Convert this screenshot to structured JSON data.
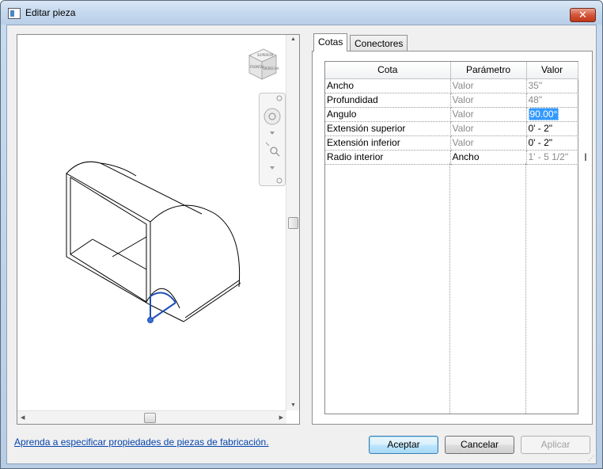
{
  "window": {
    "title": "Editar pieza",
    "close_label": "✕"
  },
  "viewport": {
    "viewcube_labels": [
      "SUPERIOR",
      "FRONTAL",
      "DERECHA"
    ]
  },
  "tabs": [
    {
      "label": "Cotas",
      "active": true
    },
    {
      "label": "Conectores",
      "active": false
    }
  ],
  "grid": {
    "headers": [
      "Cota",
      "Parámetro",
      "Valor"
    ],
    "rows": [
      {
        "cota": "Ancho",
        "parametro": "Valor",
        "valor": "35\""
      },
      {
        "cota": "Profundidad",
        "parametro": "Valor",
        "valor": "48\""
      },
      {
        "cota": "Angulo",
        "parametro": "Valor",
        "valor": "90.00°"
      },
      {
        "cota": "Extensión superior",
        "parametro": "Valor",
        "valor": "0' - 2\""
      },
      {
        "cota": "Extensión inferior",
        "parametro": "Valor",
        "valor": "0' - 2\""
      },
      {
        "cota": "Radio interior",
        "parametro": "Ancho",
        "valor": "1' - 5 1/2\""
      }
    ]
  },
  "footer": {
    "help_link": "Aprenda a especificar propiedades de piezas de fabricación.",
    "accept": "Aceptar",
    "cancel": "Cancelar",
    "apply": "Aplicar"
  },
  "colors": {
    "selection": "#3399ff",
    "link": "#0645ad",
    "geometry_highlight": "#1f4fb5"
  },
  "icons": [
    "steering-wheel-icon",
    "zoom-extents-icon",
    "viewcube-icon",
    "close-icon"
  ]
}
